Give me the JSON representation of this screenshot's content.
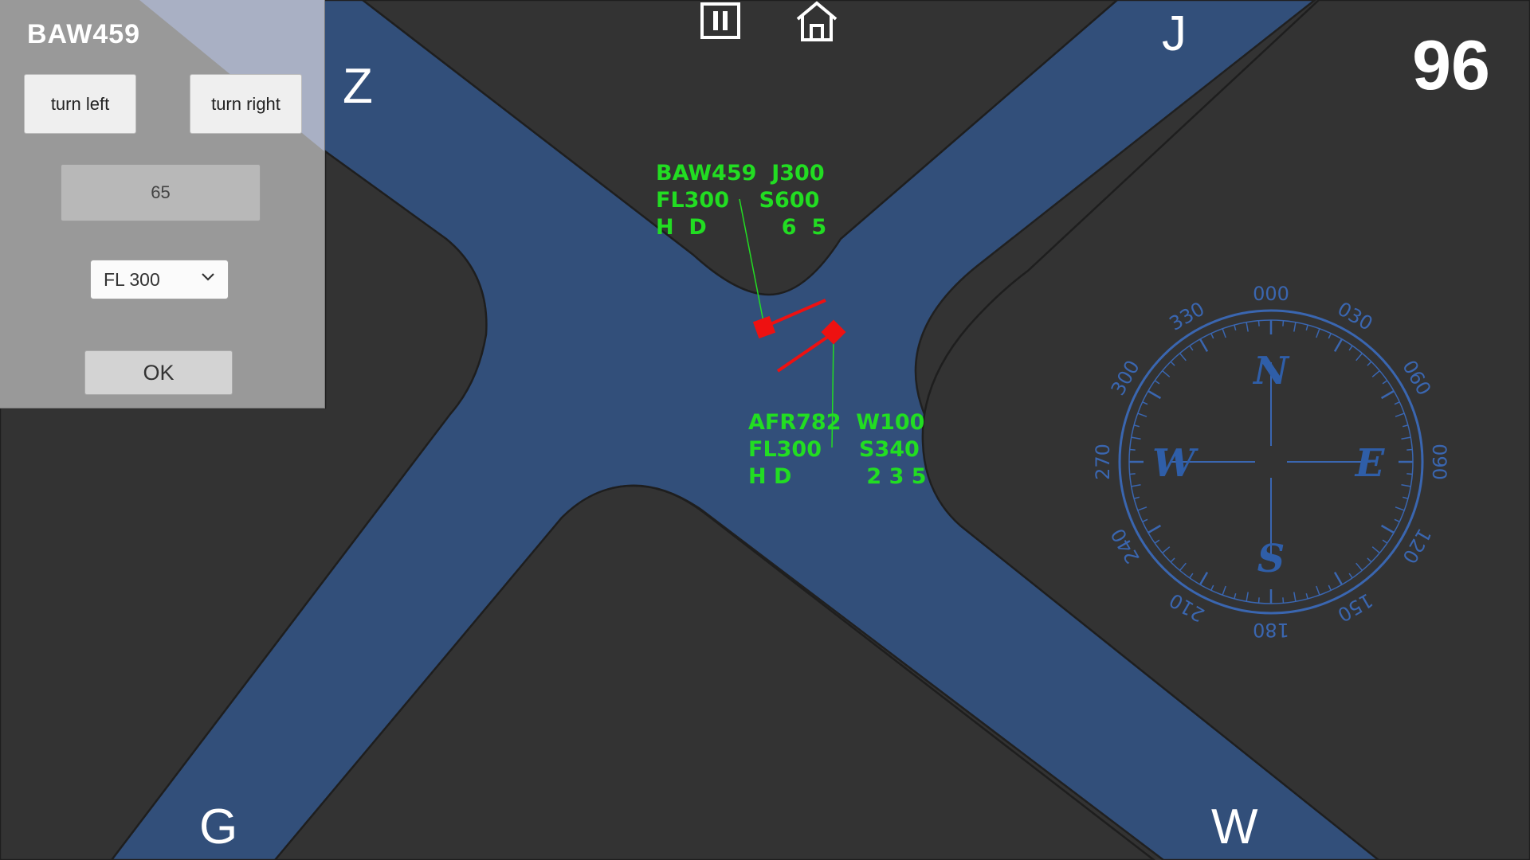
{
  "panel": {
    "callsign": "BAW459",
    "turn_left_label": "turn left",
    "turn_right_label": "turn right",
    "heading_value": "65",
    "level_selected": "FL 300",
    "ok_label": "OK"
  },
  "score": "96",
  "exits": {
    "z": "Z",
    "j": "J",
    "g": "G",
    "w": "W"
  },
  "aircraft": [
    {
      "line1": "BAW459  J300",
      "line2": "FL300    S600",
      "line3": "H  D          6  5"
    },
    {
      "line1": "AFR782  W100",
      "line2": "FL300     S340",
      "line3": "H D          2 3 5"
    }
  ],
  "compass": {
    "degree_labels": [
      "000",
      "030",
      "060",
      "090",
      "120",
      "150",
      "180",
      "210",
      "240",
      "270",
      "300",
      "330"
    ],
    "cardinals": {
      "n": "N",
      "e": "E",
      "s": "S",
      "w": "W"
    }
  },
  "top_icons": [
    "pause-icon",
    "home-icon"
  ],
  "colors": {
    "background": "#333333",
    "airway": "#324f7a",
    "label": "#22dd22",
    "aircraft": "#ee1111",
    "compass": "#3a66b0",
    "panel": "#999999"
  }
}
